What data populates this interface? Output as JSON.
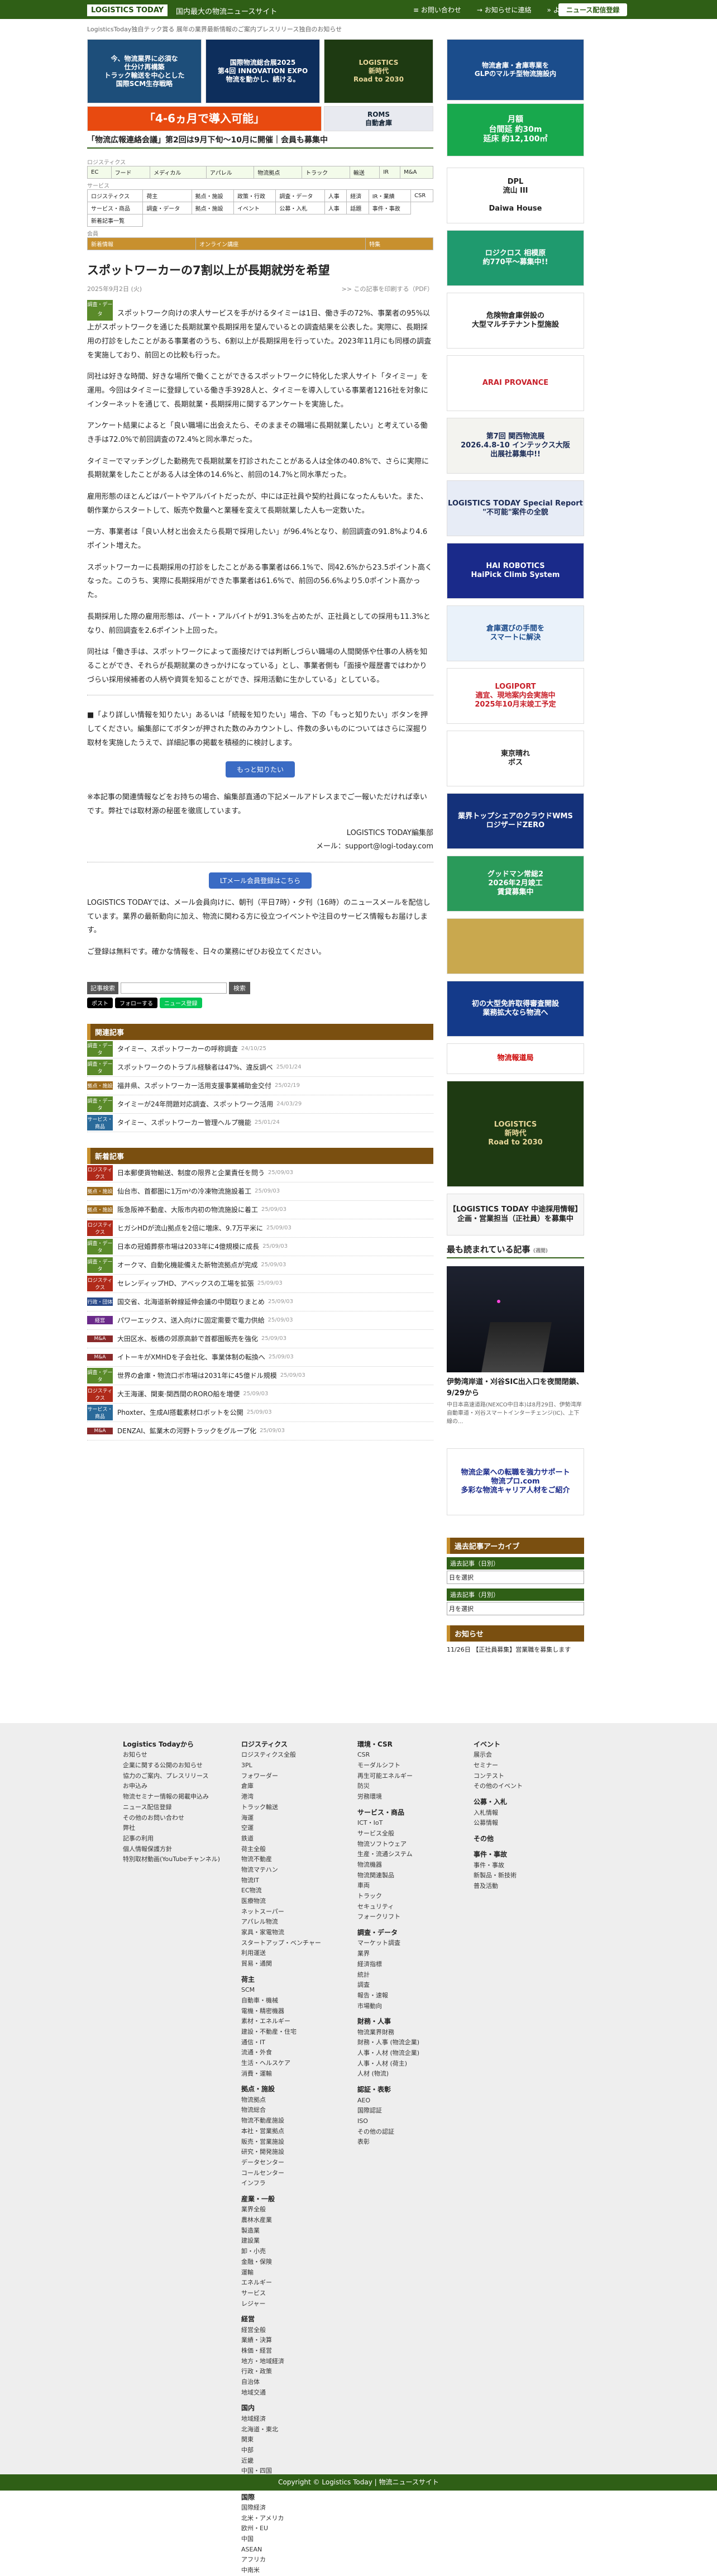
{
  "header": {
    "logo": "LOGISTICS TODAY",
    "tagline": "国内最大の物流ニュースサイト",
    "nav": [
      "≡ お問い合わせ",
      "→ お知らせに連絡",
      "» よく見るテーマ"
    ],
    "btn": "ニュース配信登録",
    "sub": "LogisticsToday独自テック賞る 展年の業界最新情報のご案内プレスリリース独自のお知らせ"
  },
  "top_ads": [
    {
      "text": "今、物流業界に必須な\n仕分け再構築\nトラック輸送を中心とした\n国際SCM生存戦略",
      "bg": "#1d4e7a",
      "color": "#fff"
    },
    {
      "text": "国際物流総合展2025\n第4回 INNOVATION EXPO\n物流を動かし、続ける。",
      "bg": "#0d2e5c",
      "color": "#fff"
    },
    {
      "text": "LOGISTICS\n新時代\nRoad to 2030",
      "bg": "#1e3a12",
      "color": "#e8d79a"
    },
    {
      "text": "物流倉庫・倉庫専業を\nGLPのマルチ型物流施設内",
      "bg": "#1b4d8c",
      "color": "#fff"
    },
    {
      "text": "「4-6ヵ月で導入可能」",
      "bg": "#e84a10",
      "color": "#fff"
    },
    {
      "text": "ROMS\n自動倉庫",
      "bg": "#e8eaf0",
      "color": "#123"
    },
    {
      "text": "月額\n台間延 約30m\n延床 約12,100㎡",
      "bg": "#18a84d",
      "color": "#fff"
    }
  ],
  "notice": "「物流広報連絡会議」第2回は9月下旬〜10月に開催｜会員も募集中",
  "cats": {
    "label1": "ロジスティクス",
    "row1": [
      "EC",
      "フード",
      "メディカル",
      "アパレル",
      "物流拠点",
      "トラック",
      "輸送",
      "IR",
      "M&A"
    ],
    "label2": "サービス",
    "row2a": [
      "ロジスティクス",
      "荷主",
      "拠点・施設",
      "政策・行政",
      "調査・データ",
      "人事",
      "経済",
      "IR・業績",
      "CSR"
    ],
    "row2b": [
      "サービス・商品",
      "調査・データ",
      "拠点・施設",
      "イベント",
      "公募・入札",
      "人事",
      "話題",
      "事件・事故"
    ],
    "row2c": [
      "新着記事一覧"
    ],
    "label3": "会員",
    "row3": [
      "新着情報",
      "オンライン講座",
      "特集"
    ]
  },
  "article": {
    "title": "スポットワーカーの7割以上が長期就労を希望",
    "date": "2025年9月2日 (火)",
    "pdf": ">> この記事を印刷する（PDF）",
    "tag": "調査・データ",
    "paragraphs": [
      "スポットワーク向けの求人サービスを手がけるタイミーは1日、働き手の72%、事業者の95%以上がスポットワークを通じた長期就業や長期採用を望んでいるとの調査結果を公表した。実際に、長期採用の打診をしたことがある事業者のうち、6割以上が長期採用を行っていた。2023年11月にも同様の調査を実施しており、前回との比較も行った。",
      "同社は好きな時間、好きな場所で働くことができるスポットワークに特化した求人サイト「タイミー」を運用。今回はタイミーに登録している働き手3928人と、タイミーを導入している事業者1216社を対象にインターネットを通じて、長期就業・長期採用に関するアンケートを実施した。",
      "アンケート結果によると「良い職場に出会えたら、そのままその職場に長期就業したい」と考えている働き手は72.0%で前回調査の72.4%と同水準だった。",
      "タイミーでマッチングした勤務先で長期就業を打診されたことがある人は全体の40.8%で、さらに実際に長期就業をしたことがある人は全体の14.6%と、前回の14.7%と同水準だった。",
      "雇用形態のほとんどはパートやアルバイトだったが、中には正社員や契約社員になったんもいた。また、朝作業からスタートして、販売や数量へと業種を変えて長期就業した人も一定数いた。",
      "一方、事業者は「良い人材と出会えたら長期で採用したい」が96.4%となり、前回調査の91.8%より4.6ポイント増えた。",
      "スポットワーカーに長期採用の打診をしたことがある事業者は66.1%で、同42.6%から23.5ポイント高くなった。このうち、実際に長期採用ができた事業者は61.6%で、前回の56.6%より5.0ポイント高かった。",
      "長期採用した際の雇用形態は、パート・アルバイトが91.3%を占めたが、正社員としての採用も11.3%となり、前回調査を2.6ポイント上回った。",
      "同社は「働き手は、スポットワークによって面接だけでは判断しづらい職場の人間関係や仕事の人柄を知ることができ、それらが長期就業のきっかけになっている」とし、事業者側も「面接や履歴書ではわかりづらい採用候補者の人柄や資質を知ることができ、採用活動に生かしている」としている。"
    ],
    "cta": "■「より詳しい情報を知りたい」あるいは「続報を知りたい」場合、下の「もっと知りたい」ボタンを押してください。編集部にてボタンが押された数のみカウントし、件数の多いものについてはさらに深掘り取材を実施したうえで、詳細記事の掲載を積極的に検討します。",
    "more_btn": "もっと知りたい",
    "contact": "※本記事の関連情報などをお持ちの場合、編集部直通の下記メールアドレスまでご一報いただければ幸いです。弊社では取材源の秘匿を徹底しています。",
    "editor": "LOGISTICS TODAY編集部",
    "mail": "メール：support@logi-today.com",
    "lt_btn": "LTメール会員登録はこちら",
    "member1": "LOGISTICS TODAYでは、メール会員向けに、朝刊（平日7時）・夕刊（16時）のニュースメールを配信しています。業界の最新動向に加え、物流に関わる方に役立つイベントや注目のサービス情報もお届けします。",
    "member2": "ご登録は無料です。確かな情報を、日々の業務にぜひお役立てください。"
  },
  "search": {
    "label": "記事検索",
    "placeholder": "",
    "btn": "検索",
    "share": [
      "ポスト",
      "フォローする",
      "ニュース登録"
    ]
  },
  "related": {
    "title": "関連記事",
    "items": [
      {
        "tag": "調査・データ",
        "tagc": "#5a8a2a",
        "title": "タイミー、スポットワーカーの呼称調査",
        "date": "24/10/25"
      },
      {
        "tag": "調査・データ",
        "tagc": "#5a8a2a",
        "title": "スポットワークのトラブル経験者は47%、違反調べ",
        "date": "25/01/24"
      },
      {
        "tag": "拠点・施設",
        "tagc": "#9c6a1c",
        "title": "福井県、スポットワーカー活用支援事業補助金交付",
        "date": "25/02/19"
      },
      {
        "tag": "調査・データ",
        "tagc": "#5a8a2a",
        "title": "タイミーが24年問題対応調査、スポットワーク活用",
        "date": "24/03/29"
      },
      {
        "tag": "サービス・商品",
        "tagc": "#2a6a9a",
        "title": "タイミー、スポットワーカー管理ヘルプ機能",
        "date": "25/01/24"
      }
    ]
  },
  "latest": {
    "title": "新着記事",
    "items": [
      {
        "tag": "ロジスティクス",
        "tagc": "#b02a1a",
        "title": "日本郵便貨物輸送、制度の限界と企業責任を問う",
        "date": "25/09/03"
      },
      {
        "tag": "拠点・施設",
        "tagc": "#9c6a1c",
        "title": "仙台市、首都圏に1万m²の冷凍物流施設着工",
        "date": "25/09/03"
      },
      {
        "tag": "拠点・施設",
        "tagc": "#9c6a1c",
        "title": "阪急阪神不動産、大阪市内初の物流施設に着工",
        "date": "25/09/03"
      },
      {
        "tag": "ロジスティクス",
        "tagc": "#b02a1a",
        "title": "ヒガシHDが流山拠点を2倍に増床、9.7万平米に",
        "date": "25/09/03"
      },
      {
        "tag": "調査・データ",
        "tagc": "#5a8a2a",
        "title": "日本の冠婚葬祭市場は2033年に4億規模に成長",
        "date": "25/09/03"
      },
      {
        "tag": "調査・データ",
        "tagc": "#5a8a2a",
        "title": "オークマ、自動化機能備えた新物流拠点が完成",
        "date": "25/09/03"
      },
      {
        "tag": "ロジスティクス",
        "tagc": "#b02a1a",
        "title": "セレンディップHD、アベックスの工場を拡張",
        "date": "25/09/03"
      },
      {
        "tag": "行政・団体",
        "tagc": "#2a4a8a",
        "title": "国交省、北海道新幹線延伸会議の中間取りまとめ",
        "date": "25/09/03"
      },
      {
        "tag": "経営",
        "tagc": "#6a2a8a",
        "title": "パワーエックス、送入向けに固定需要で電力供給",
        "date": "25/09/03"
      },
      {
        "tag": "M&A",
        "tagc": "#8a2a2a",
        "title": "大田区水、板橋の郊原高齢で首都圏販売を強化",
        "date": "25/09/03"
      },
      {
        "tag": "M&A",
        "tagc": "#8a2a2a",
        "title": "イトーキがXMHDを子会社化、事業体制の転換へ",
        "date": "25/09/03"
      },
      {
        "tag": "調査・データ",
        "tagc": "#5a8a2a",
        "title": "世界の倉庫・物流口ボ市場は2031年に45億ドル規模",
        "date": "25/09/03"
      },
      {
        "tag": "ロジスティクス",
        "tagc": "#b02a1a",
        "title": "大王海運、関東·関西間のRORO船を増便",
        "date": "25/09/03"
      },
      {
        "tag": "サービス・商品",
        "tagc": "#2a6a9a",
        "title": "Phoxter、生成AI搭載素材ロボットを公開",
        "date": "25/09/03"
      },
      {
        "tag": "M&A",
        "tagc": "#8a2a2a",
        "title": "DENZAI、鉱業木の河野トラックをグループ化",
        "date": "25/09/03"
      }
    ]
  },
  "sidebar": {
    "ads": [
      {
        "text": "DPL\n流山 III\n\nDaiwa House",
        "bg": "#fff",
        "color": "#222",
        "h": 100
      },
      {
        "text": "ロジクロス 相模原\n約770平〜募集中!!",
        "bg": "#1f9a6e",
        "color": "#fff",
        "h": 100
      },
      {
        "text": "危険物倉庫併設の\n大型マルチテナント型施設",
        "bg": "#fff",
        "color": "#222",
        "h": 100
      },
      {
        "text": "ARAI PROVANCE",
        "bg": "#fff",
        "color": "#c8202a",
        "h": 100
      },
      {
        "text": "第7回 関西物流展\n2026.4.8-10 インテックス大阪\n出展社募集中!!",
        "bg": "#f3f3ef",
        "color": "#1a2a55",
        "h": 100
      },
      {
        "text": "LOGISTICS TODAY Special Report\n\"不可能\"案件の全貌",
        "bg": "#e7ecf6",
        "color": "#1a2a55",
        "h": 100
      },
      {
        "text": "HAI ROBOTICS\nHaiPick Climb System",
        "bg": "#1a2a8a",
        "color": "#fff",
        "h": 100
      },
      {
        "text": "倉庫選びの手間を\nスマートに解決",
        "bg": "#eaf2fa",
        "color": "#1a4a8a",
        "h": 100
      },
      {
        "text": "LOGIPORT\n適宜、現地案内会実施中\n2025年10月末竣工予定",
        "bg": "#fff",
        "color": "#c8202a",
        "h": 100
      },
      {
        "text": "東京晴れ\nボス",
        "bg": "#fff",
        "color": "#222",
        "h": 100
      },
      {
        "text": "業界トップシェアのクラウドWMS\nロジザードZERO",
        "bg": "#14317a",
        "color": "#fff",
        "h": 100
      },
      {
        "text": "グッドマン常総2\n2026年2月竣工\n賃貸募集中",
        "bg": "#2a9a5a",
        "color": "#fff",
        "h": 100
      },
      {
        "text": "",
        "bg": "#c9a84e",
        "color": "#fff",
        "h": 100
      },
      {
        "text": "初の大型免許取得審査開設\n業務拡大なら物流へ",
        "bg": "#143a8a",
        "color": "#fff",
        "h": 100
      },
      {
        "text": "物流報道局",
        "bg": "#fff",
        "color": "#c00",
        "h": 55
      },
      {
        "text": "LOGISTICS\n新時代\nRoad to 2030",
        "bg": "#1e3a12",
        "color": "#e8d79a",
        "h": 190
      },
      {
        "text": "【LOGISTICS TODAY 中途採用情報】\n企画・営業担当（正社員）を募集中",
        "bg": "#f7f7f7",
        "color": "#222",
        "h": 75
      }
    ],
    "popular": "最も読まれている記事",
    "pop_note": "(週間)",
    "pop_title": "伊勢湾岸道・刈谷SIC出入口を夜間閉鎖、9/29から",
    "pop_sub": "中日本高速道路(NEXCO中日本)は8月29日、伊勢湾岸自動車道・刈谷スマートインターチェンジ(IC)、上下線の...",
    "pro_ad": "物流企業への転職を強力サポート\n物流プロ.com\n多彩な物流キャリア人材をご紹介",
    "archive": "過去記事アーカイブ",
    "arch1": "過去記事（日別）",
    "sel1": "日を選択",
    "arch2": "過去記事（月別）",
    "sel2": "月を選択",
    "notice": "お知らせ",
    "notice_text": "11/26日 【正社員募集】営業職を募集します"
  },
  "footer": {
    "cols": [
      {
        "title": "Logistics Todayから",
        "items": [
          "お知らせ",
          "企業に関する公開のお知らせ",
          "協力のご案内、プレスリリース",
          "お申込み",
          "物流セミナー情報の掲載申込み",
          "ニュース配信登録",
          "その他のお問い合わせ",
          "弊社",
          "記事の利用",
          "個人情報保護方針",
          "特別取材動画(YouTubeチャンネル)"
        ]
      },
      {
        "title": "ロジスティクス",
        "items": [
          "ロジスティクス全般",
          "3PL",
          "フォワーダー",
          "倉庫",
          "港湾",
          "トラック輸送",
          "海運",
          "空運",
          "鉄道",
          "荷主全般",
          "物流不動産",
          "物流マテハン",
          "物流IT",
          "EC物流",
          "医療物流",
          "ネットスーパー",
          "アパレル物流",
          "家具・家電物流",
          "スタートアップ・ベンチャー",
          "利用運送",
          "貿易・通関"
        ]
      },
      {
        "title": "荷主",
        "items": [
          "SCM",
          "自動車・機械",
          "電機・精密機器",
          "素材・エネルギー",
          "建設・不動産・住宅",
          "通信・IT",
          "流通・外食",
          "生活・ヘルスケア",
          "消費・運輸"
        ]
      },
      {
        "title": "拠点・施設",
        "items": [
          "物流拠点",
          "物流総合",
          "物流不動産施設",
          "本社・営業拠点",
          "販売・営業施設",
          "研究・開発施設",
          "データセンター",
          "コールセンター",
          "インフラ"
        ]
      },
      {
        "title": "産業・一般",
        "items": [
          "業界全般",
          "農林水産業",
          "製造業",
          "建設業",
          "卸・小売",
          "金融・保険",
          "運輸",
          "エネルギー",
          "サービス",
          "レジャー"
        ]
      },
      {
        "title": "経営",
        "items": [
          "経営全般",
          "業績・決算",
          "株価・経営",
          "地方・地域経済",
          "行政・政策",
          "自治体",
          "地域交通"
        ]
      },
      {
        "title": "国内",
        "items": [
          "地域経済",
          "北海道・東北",
          "関東",
          "中部",
          "近畿",
          "中国・四国",
          "九州・沖縄"
        ]
      },
      {
        "title": "国際",
        "items": [
          "国際経済",
          "北米・アメリカ",
          "欧州・EU",
          "中国",
          "ASEAN",
          "アフリカ",
          "中南米"
        ]
      },
      {
        "title": "環境・CSR",
        "items": [
          "CSR",
          "モーダルシフト",
          "再生可能エネルギー",
          "防災",
          "労務環境"
        ]
      },
      {
        "title": "サービス・商品",
        "items": [
          "ICT・IoT",
          "サービス全般",
          "物流ソフトウェア",
          "生産・流通システム",
          "物流機器",
          "物流関連製品",
          "車両",
          "トラック",
          "セキュリティ",
          "フォークリフト"
        ]
      },
      {
        "title": "調査・データ",
        "items": [
          "マーケット調査",
          "業界",
          "経済指標",
          "統計",
          "調査",
          "報告・速報",
          "市場動向"
        ]
      },
      {
        "title": "財務・人事",
        "items": [
          "物流業界財務",
          "財務・人事 (物流企業)",
          "人事・人材 (物流企業)",
          "人事・人材 (荷主)",
          "人材 (物流)"
        ]
      },
      {
        "title": "認証・表彰",
        "items": [
          "AEO",
          "国際認証",
          "ISO",
          "その他の認証",
          "表彰"
        ]
      },
      {
        "title": "イベント",
        "items": [
          "展示会",
          "セミナー",
          "コンテスト",
          "その他のイベント"
        ]
      },
      {
        "title": "公募・入札",
        "items": [
          "入札情報",
          "公募情報"
        ]
      },
      {
        "title": "その他",
        "items": []
      },
      {
        "title": "事件・事故",
        "items": [
          "事件・事故",
          "新製品・新技術",
          "普及活動"
        ]
      }
    ],
    "copyright": "Copyright © Logistics Today | 物流ニュースサイト"
  }
}
